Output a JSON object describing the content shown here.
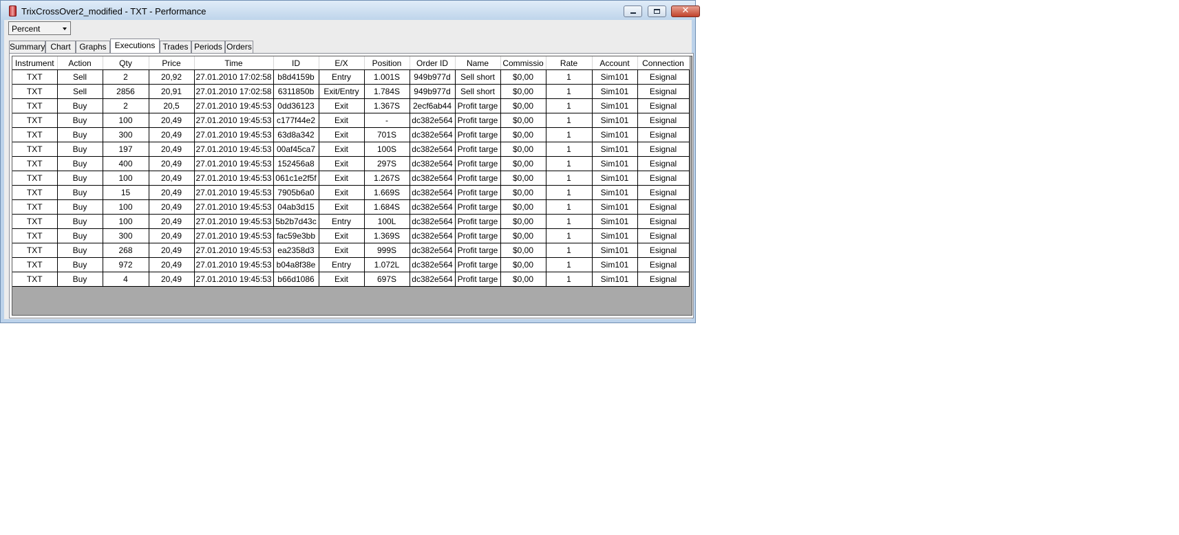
{
  "window": {
    "title": "TrixCrossOver2_modified - TXT - Performance",
    "close_glyph": "✕"
  },
  "display_mode": {
    "selected": "Percent"
  },
  "tabs": [
    {
      "label": "Summary",
      "active": false
    },
    {
      "label": "Chart",
      "active": false
    },
    {
      "label": "Graphs",
      "active": false
    },
    {
      "label": "Executions",
      "active": true
    },
    {
      "label": "Trades",
      "active": false
    },
    {
      "label": "Periods",
      "active": false
    },
    {
      "label": "Orders",
      "active": false
    }
  ],
  "executions": {
    "columns": [
      "Instrument",
      "Action",
      "Qty",
      "Price",
      "Time",
      "ID",
      "E/X",
      "Position",
      "Order ID",
      "Name",
      "Commissio",
      "Rate",
      "Account",
      "Connection"
    ],
    "rows": [
      [
        "TXT",
        "Sell",
        "2",
        "20,92",
        "27.01.2010 17:02:58",
        "b8d4159b",
        "Entry",
        "1.001S",
        "949b977d",
        "Sell short",
        "$0,00",
        "1",
        "Sim101",
        "Esignal"
      ],
      [
        "TXT",
        "Sell",
        "2856",
        "20,91",
        "27.01.2010 17:02:58",
        "6311850b",
        "Exit/Entry",
        "1.784S",
        "949b977d",
        "Sell short",
        "$0,00",
        "1",
        "Sim101",
        "Esignal"
      ],
      [
        "TXT",
        "Buy",
        "2",
        "20,5",
        "27.01.2010 19:45:53",
        "0dd36123",
        "Exit",
        "1.367S",
        "2ecf6ab44",
        "Profit targe",
        "$0,00",
        "1",
        "Sim101",
        "Esignal"
      ],
      [
        "TXT",
        "Buy",
        "100",
        "20,49",
        "27.01.2010 19:45:53",
        "c177f44e2",
        "Exit",
        "-",
        "dc382e564",
        "Profit targe",
        "$0,00",
        "1",
        "Sim101",
        "Esignal"
      ],
      [
        "TXT",
        "Buy",
        "300",
        "20,49",
        "27.01.2010 19:45:53",
        "63d8a342",
        "Exit",
        "701S",
        "dc382e564",
        "Profit targe",
        "$0,00",
        "1",
        "Sim101",
        "Esignal"
      ],
      [
        "TXT",
        "Buy",
        "197",
        "20,49",
        "27.01.2010 19:45:53",
        "00af45ca7",
        "Exit",
        "100S",
        "dc382e564",
        "Profit targe",
        "$0,00",
        "1",
        "Sim101",
        "Esignal"
      ],
      [
        "TXT",
        "Buy",
        "400",
        "20,49",
        "27.01.2010 19:45:53",
        "152456a8",
        "Exit",
        "297S",
        "dc382e564",
        "Profit targe",
        "$0,00",
        "1",
        "Sim101",
        "Esignal"
      ],
      [
        "TXT",
        "Buy",
        "100",
        "20,49",
        "27.01.2010 19:45:53",
        "061c1e2f5f",
        "Exit",
        "1.267S",
        "dc382e564",
        "Profit targe",
        "$0,00",
        "1",
        "Sim101",
        "Esignal"
      ],
      [
        "TXT",
        "Buy",
        "15",
        "20,49",
        "27.01.2010 19:45:53",
        "7905b6a0",
        "Exit",
        "1.669S",
        "dc382e564",
        "Profit targe",
        "$0,00",
        "1",
        "Sim101",
        "Esignal"
      ],
      [
        "TXT",
        "Buy",
        "100",
        "20,49",
        "27.01.2010 19:45:53",
        "04ab3d15",
        "Exit",
        "1.684S",
        "dc382e564",
        "Profit targe",
        "$0,00",
        "1",
        "Sim101",
        "Esignal"
      ],
      [
        "TXT",
        "Buy",
        "100",
        "20,49",
        "27.01.2010 19:45:53",
        "5b2b7d43c",
        "Entry",
        "100L",
        "dc382e564",
        "Profit targe",
        "$0,00",
        "1",
        "Sim101",
        "Esignal"
      ],
      [
        "TXT",
        "Buy",
        "300",
        "20,49",
        "27.01.2010 19:45:53",
        "fac59e3bb",
        "Exit",
        "1.369S",
        "dc382e564",
        "Profit targe",
        "$0,00",
        "1",
        "Sim101",
        "Esignal"
      ],
      [
        "TXT",
        "Buy",
        "268",
        "20,49",
        "27.01.2010 19:45:53",
        "ea2358d3",
        "Exit",
        "999S",
        "dc382e564",
        "Profit targe",
        "$0,00",
        "1",
        "Sim101",
        "Esignal"
      ],
      [
        "TXT",
        "Buy",
        "972",
        "20,49",
        "27.01.2010 19:45:53",
        "b04a8f38e",
        "Entry",
        "1.072L",
        "dc382e564",
        "Profit targe",
        "$0,00",
        "1",
        "Sim101",
        "Esignal"
      ],
      [
        "TXT",
        "Buy",
        "4",
        "20,49",
        "27.01.2010 19:45:53",
        "b66d1086",
        "Exit",
        "697S",
        "dc382e564",
        "Profit targe",
        "$0,00",
        "1",
        "Sim101",
        "Esignal"
      ]
    ]
  },
  "colors": {
    "titlebar": "#bcd3ea",
    "grid_background": "#a9a9a9",
    "close_button": "#c0432c"
  }
}
